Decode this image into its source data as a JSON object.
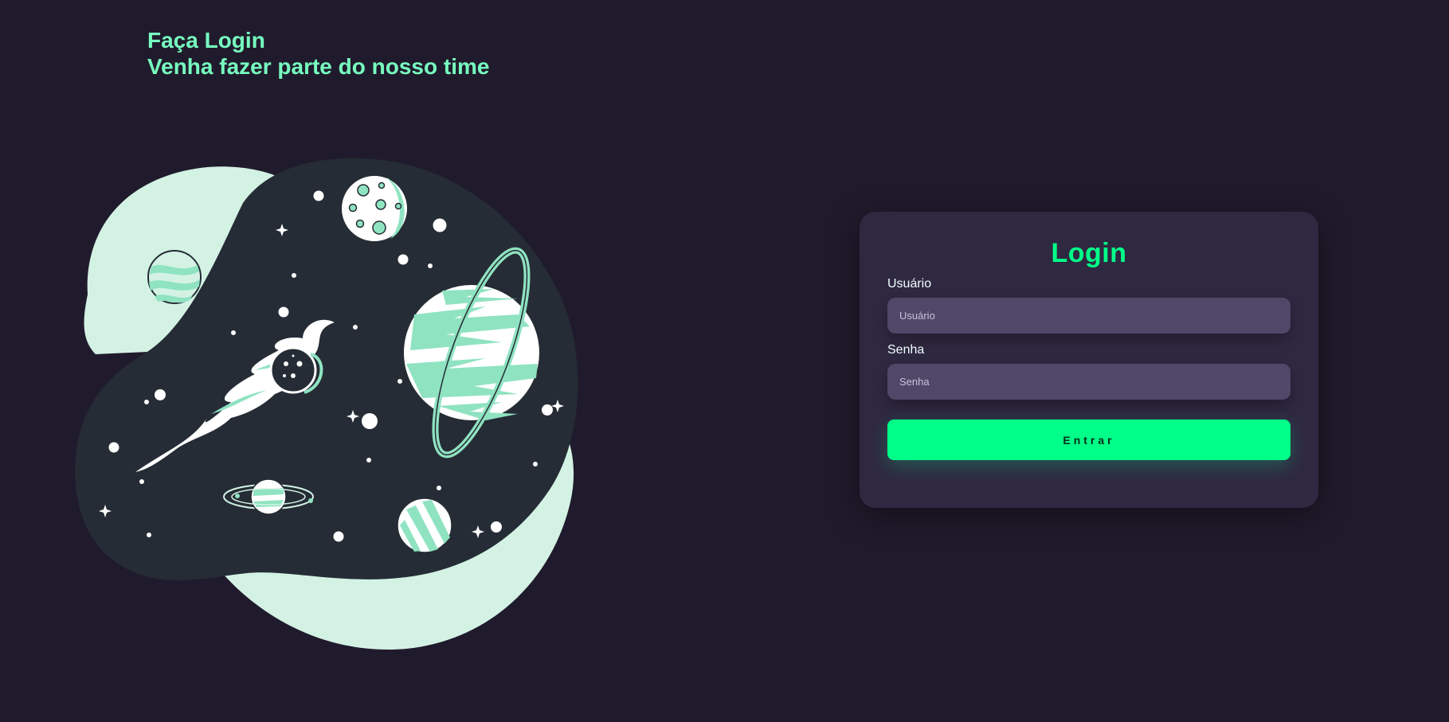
{
  "hero": {
    "line1": "Faça Login",
    "line2": "Venha fazer parte do nosso time"
  },
  "illustration": {
    "icon": "space-planets-illustration"
  },
  "login_card": {
    "title": "Login",
    "username_label": "Usuário",
    "username_placeholder": "Usuário",
    "username_value": "",
    "password_label": "Senha",
    "password_placeholder": "Senha",
    "password_value": "",
    "submit_label": "Entrar"
  },
  "colors": {
    "background": "#201b2c",
    "card": "#2f2841",
    "input": "#514869",
    "accent": "#00ff88",
    "hero_text": "#77ffc0",
    "mint": "#d3f2e4",
    "space": "#252c35",
    "planet_green": "#8fe3c1"
  }
}
